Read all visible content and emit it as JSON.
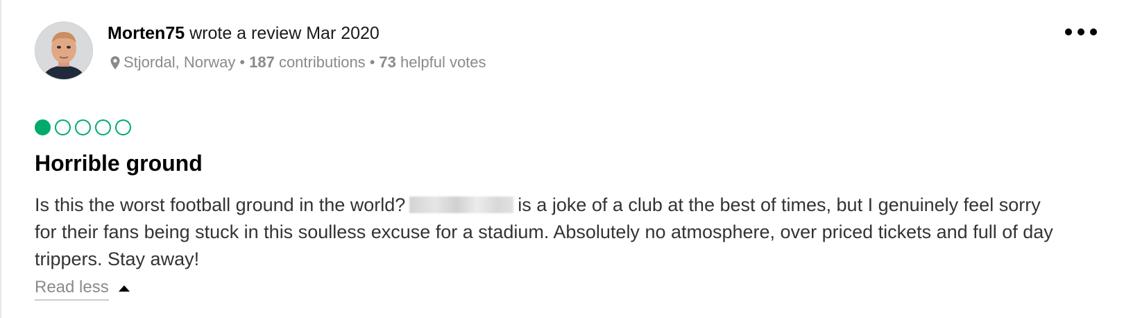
{
  "review": {
    "author": {
      "username": "Morten75",
      "action_text": "wrote a review",
      "date": "Mar 2020",
      "location": "Stjordal, Norway",
      "contributions_count": "187",
      "contributions_label": "contributions",
      "helpful_votes_count": "73",
      "helpful_votes_label": "helpful votes",
      "avatar_icon": "user-avatar-photo",
      "location_icon": "map-pin-icon"
    },
    "more_menu_icon": "more-options-icon",
    "rating": {
      "value": 1,
      "max": 5,
      "color": "#00aa6c"
    },
    "title": "Horrible ground",
    "body_before_redaction": "Is this the worst football ground in the world?",
    "body_after_redaction": "is a joke of a club at the best of times, but I genuinely feel sorry for their fans being stuck in this soulless excuse for a stadium. Absolutely no atmosphere, over priced tickets and full of day trippers. Stay away!",
    "read_less_label": "Read less",
    "read_less_icon": "caret-up-icon"
  }
}
